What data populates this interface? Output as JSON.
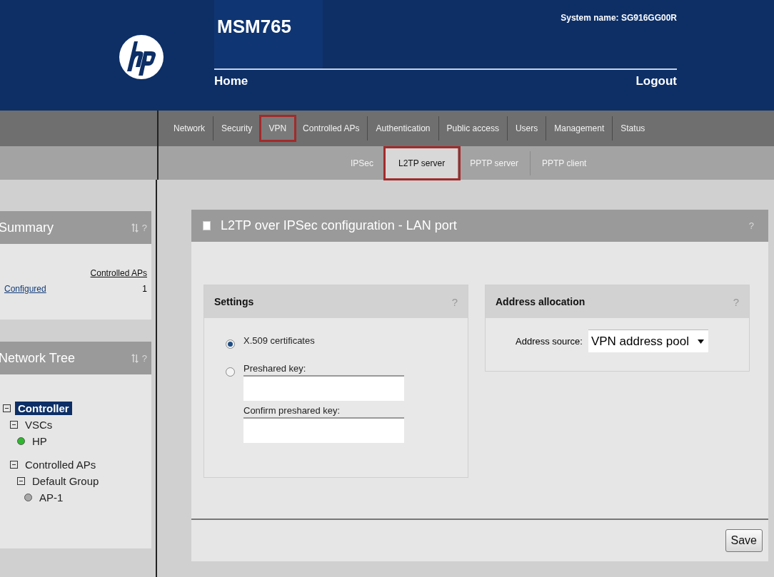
{
  "header": {
    "product": "MSM765",
    "system_name": "System name: SG916GG00R",
    "links": [
      "Home",
      "Logout"
    ]
  },
  "nav": [
    {
      "label": "Network",
      "selected": false
    },
    {
      "label": "Security",
      "selected": false
    },
    {
      "label": "VPN",
      "selected": true
    },
    {
      "label": "Controlled APs",
      "selected": false
    },
    {
      "label": "Authentication",
      "selected": false
    },
    {
      "label": "Public access",
      "selected": false
    },
    {
      "label": "Users",
      "selected": false
    },
    {
      "label": "Management",
      "selected": false
    },
    {
      "label": "Status",
      "selected": false
    }
  ],
  "subnav": [
    {
      "label": "IPSec",
      "selected": false
    },
    {
      "label": "L2TP server",
      "selected": true
    },
    {
      "label": "PPTP server",
      "selected": false
    },
    {
      "label": "PPTP client",
      "selected": false
    }
  ],
  "sidebar": {
    "summary": {
      "title": "Summary",
      "help": "?",
      "column": "Controlled APs",
      "rows": [
        {
          "label": "Configured",
          "value": "1"
        }
      ]
    },
    "tree": {
      "title": "Network Tree",
      "help": "?",
      "nodes": [
        {
          "label": "Controller",
          "kind": "folder",
          "expanded": true,
          "selected": true,
          "children": [
            {
              "label": "VSCs",
              "kind": "folder",
              "expanded": true,
              "selected": false,
              "children": [
                {
                  "label": "HP",
                  "kind": "device",
                  "color": "#2fb82f",
                  "selected": false
                }
              ]
            },
            {
              "label": "Controlled APs",
              "kind": "folder",
              "expanded": true,
              "selected": false,
              "children": [
                {
                  "label": "Default Group",
                  "kind": "folder",
                  "expanded": true,
                  "selected": false,
                  "children": [
                    {
                      "label": "AP-1",
                      "kind": "device",
                      "color": "#a8a8a8",
                      "selected": false
                    }
                  ]
                }
              ]
            }
          ]
        }
      ]
    }
  },
  "panel": {
    "title": "L2TP over IPSec configuration - LAN port",
    "help": "?",
    "settings": {
      "title": "Settings",
      "help": "?",
      "options": [
        {
          "label": "X.509 certificates",
          "kind": "plain",
          "selected": true
        },
        {
          "label": "Preshared key:",
          "kind": "key",
          "selected": false,
          "confirm_label": "Confirm preshared key:"
        }
      ]
    },
    "address": {
      "title": "Address allocation",
      "help": "?",
      "label": "Address source:",
      "value": "VPN address pool"
    },
    "save": "Save"
  }
}
